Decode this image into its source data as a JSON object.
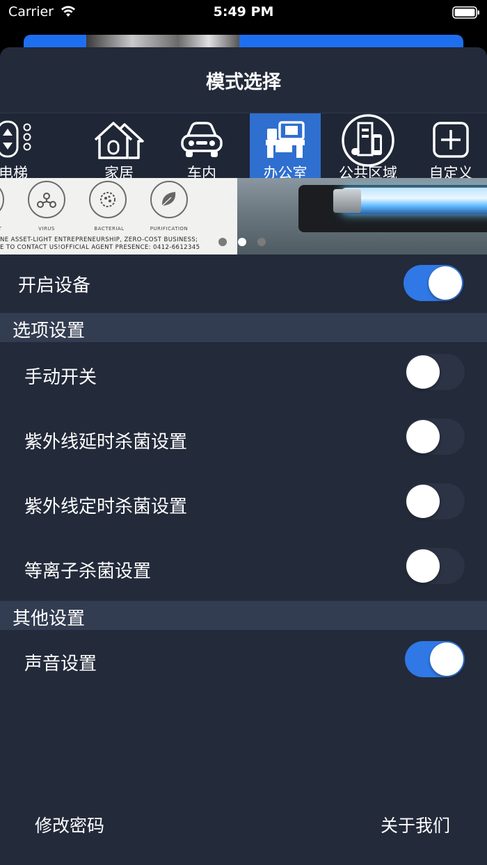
{
  "status_bar": {
    "carrier": "Carrier",
    "time": "5:49 PM"
  },
  "sheet": {
    "title": "模式选择"
  },
  "modes": [
    {
      "label": "电梯",
      "icon": "elevator-icon",
      "active": false
    },
    {
      "label": "家居",
      "icon": "home-icon",
      "active": false
    },
    {
      "label": "车内",
      "icon": "car-icon",
      "active": false
    },
    {
      "label": "办公室",
      "icon": "office-icon",
      "active": true
    },
    {
      "label": "公共区域",
      "icon": "public-area-icon",
      "active": false
    },
    {
      "label": "自定义",
      "icon": "add-custom-icon",
      "active": false
    }
  ],
  "banner": {
    "icon_labels": [
      "T",
      "VIRUS",
      "BACTERIAL",
      "PURIFICATION"
    ],
    "line1": "NE ASSET-LIGHT ENTREPRENEURSHIP, ZERO-COST BUSINESS;",
    "line2": "E TO CONTACT US!OFFICIAL AGENT PRESENCE: 0412-6612345",
    "page_count": 3,
    "active_page": 1
  },
  "device_toggle": {
    "label": "开启设备",
    "on": true
  },
  "options_section": {
    "header": "选项设置",
    "items": [
      {
        "label": "手动开关",
        "on": false
      },
      {
        "label": "紫外线延时杀菌设置",
        "on": false
      },
      {
        "label": "紫外线定时杀菌设置",
        "on": false
      },
      {
        "label": "等离子杀菌设置",
        "on": false
      }
    ]
  },
  "other_section": {
    "header": "其他设置",
    "items": [
      {
        "label": "声音设置",
        "on": true
      }
    ]
  },
  "footer": {
    "change_password": "修改密码",
    "about_us": "关于我们"
  },
  "colors": {
    "sheet_bg": "#232a3a",
    "section_bg": "#333d51",
    "accent": "#2f78e5",
    "active_mode": "#2f6fcf"
  }
}
